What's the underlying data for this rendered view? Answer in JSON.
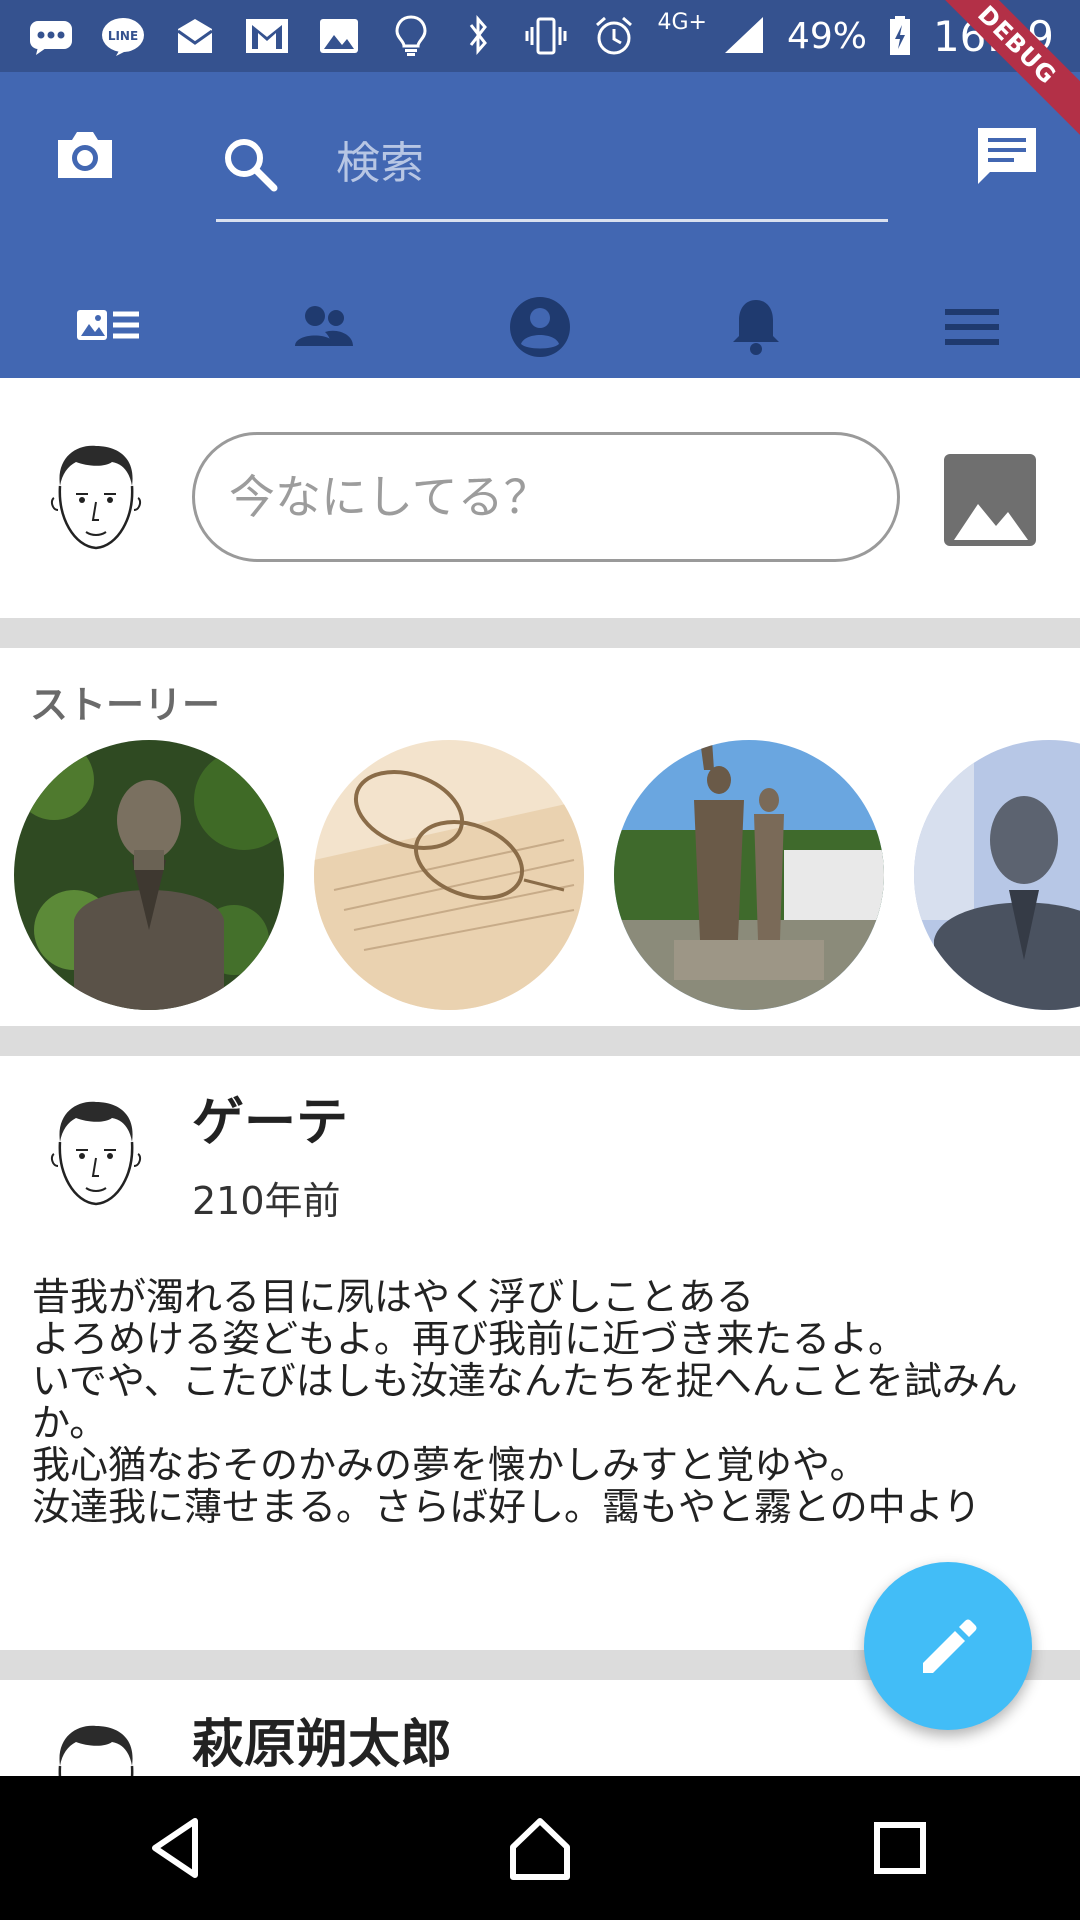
{
  "status_bar": {
    "network": "4G+",
    "battery": "49%",
    "time": "16:09",
    "debug_label": "DEBUG",
    "left_icons": [
      "messages-icon",
      "line-icon",
      "email-icon",
      "gmail-icon",
      "image-icon",
      "lightbulb-icon"
    ],
    "right_icons": [
      "bluetooth-icon",
      "vibrate-icon",
      "alarm-icon",
      "signal-icon",
      "battery-charging-icon"
    ]
  },
  "app_bar": {
    "search_placeholder": "検索",
    "tabs": [
      "news-feed-icon",
      "friends-icon",
      "profile-icon",
      "notifications-icon",
      "menu-icon"
    ],
    "colors": {
      "primary": "#4267b2",
      "status_bar": "#35528f"
    }
  },
  "composer": {
    "placeholder": "今なにしてる？"
  },
  "stories": {
    "title": "ストーリー",
    "items": [
      "story-bust-portrait",
      "story-glasses-book",
      "story-statues",
      "story-bust-glasses"
    ]
  },
  "posts": [
    {
      "name": "ゲーテ",
      "time": "210年前",
      "body": "昔我が濁れる目に夙はやく浮びしことある\nよろめける姿どもよ。再び我前に近づき来たるよ。\nいでや、こたびはしも汝達なんたちを捉へんことを試みんか。\n我心猶なおそのかみの夢を懐かしみすと覚ゆや。\n汝達我に薄せまる。さらば好し。靄もやと霧との中より"
    },
    {
      "name": "萩原朔太郎"
    }
  ],
  "fab": {
    "icon": "edit-icon",
    "color": "#42bdf7"
  },
  "nav_bar": [
    "back-icon",
    "home-icon",
    "recents-icon"
  ]
}
